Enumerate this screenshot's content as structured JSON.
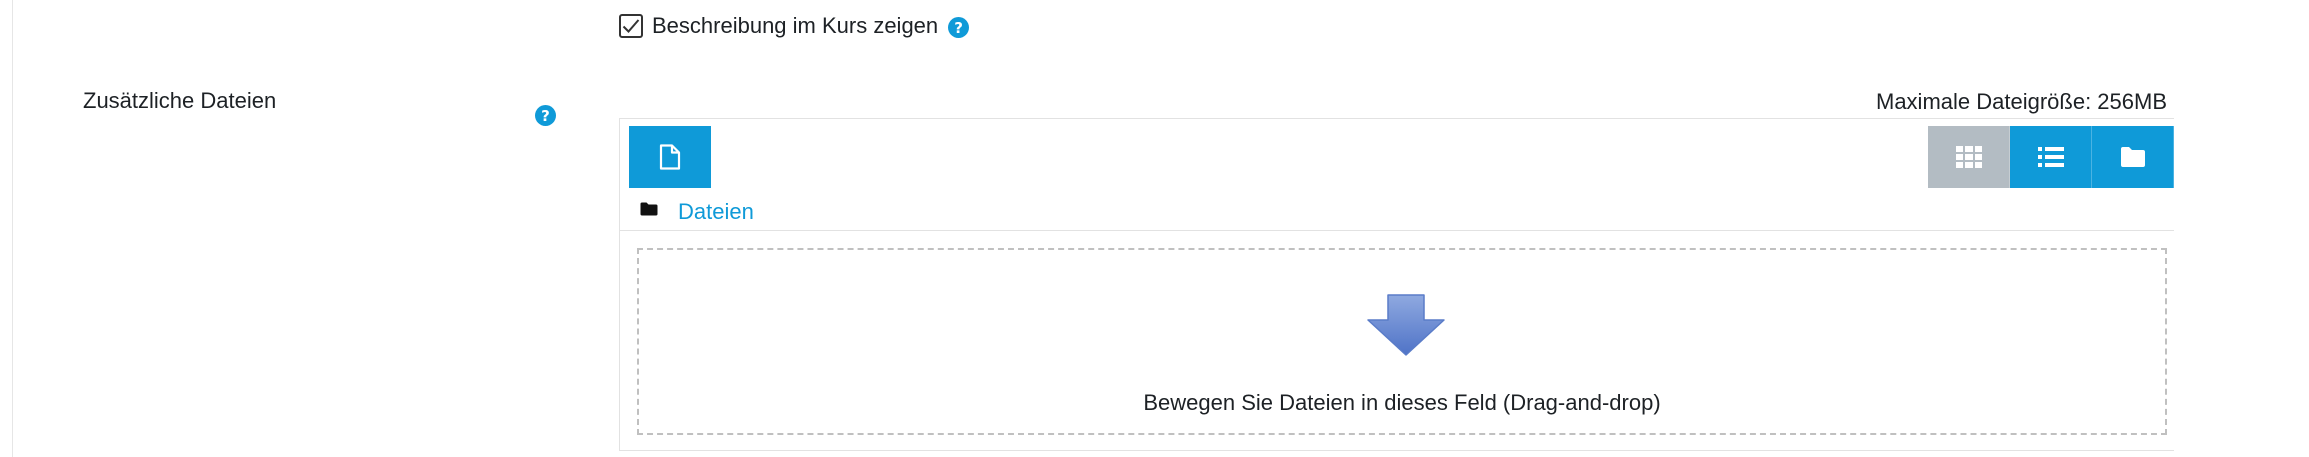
{
  "description_option": {
    "checked": true,
    "label": "Beschreibung im Kurs zeigen",
    "help_icon": "question-circle-icon"
  },
  "additional_files": {
    "label": "Zusätzliche Dateien",
    "help_icon": "question-circle-icon",
    "max_size_text": "Maximale Dateigröße: 256MB"
  },
  "filemanager": {
    "add_icon": "file-icon",
    "views": [
      {
        "icon": "grid-icon",
        "active": true
      },
      {
        "icon": "list-icon",
        "active": false
      },
      {
        "icon": "folder-icon",
        "active": false
      }
    ],
    "path_icon": "folder-icon",
    "path_label": "Dateien",
    "dropzone_icon": "down-arrow-icon",
    "dropzone_text": "Bewegen Sie Dateien in dieses Feld (Drag-and-drop)"
  },
  "colors": {
    "accent": "#0f9ad8",
    "active_view": "#b3bcc3",
    "text": "#1d2125"
  }
}
